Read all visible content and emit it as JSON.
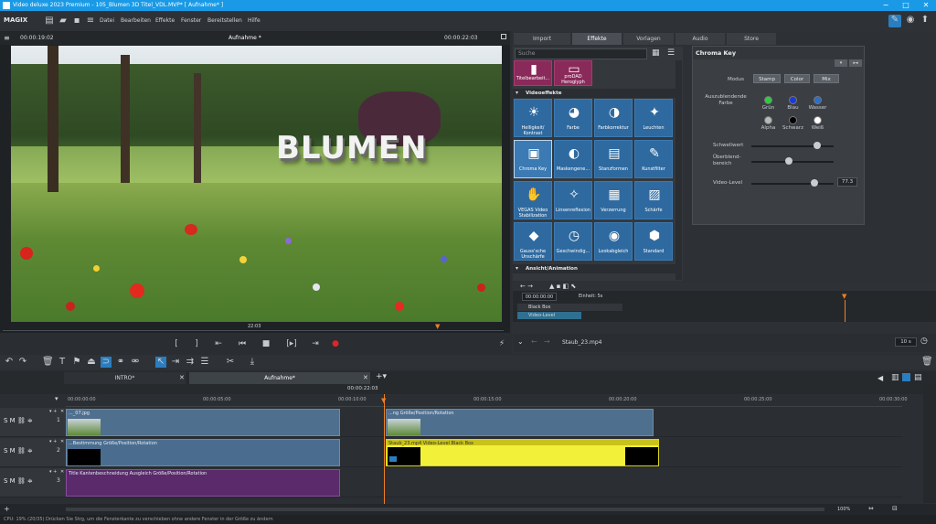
{
  "window": {
    "title": "Video deluxe 2023 Premium - 105_Blumen 3D Titel_VDL.MVP* [ Aufnahme* ]",
    "controls": [
      "−",
      "□",
      "✕"
    ]
  },
  "menu": {
    "logo": "MAGIX",
    "items": [
      "Datei",
      "Bearbeiten",
      "Effekte",
      "Fenster",
      "Bereitstellen",
      "Hilfe"
    ]
  },
  "preview": {
    "timecode_left": "00:00:19:02",
    "title": "Aufnahme *",
    "timecode_right": "00:00:22:03",
    "overlay_text": "BLUMEN",
    "position_marker": "22:03"
  },
  "right_panel": {
    "tabs": [
      "Import",
      "Effekte",
      "Vorlagen",
      "Audio",
      "Store"
    ],
    "active_tab": "Effekte",
    "search_placeholder": "Suche",
    "top_tiles": [
      {
        "label": "Titelbearbeit...",
        "icon": "title-editor-icon"
      },
      {
        "label": "proDAD Heroglyph",
        "icon": "heroglyph-icon"
      }
    ],
    "section_video": "Videoeffekte",
    "section_anim": "Ansicht/Animation",
    "effects": [
      {
        "label": "Helligkeit/ Kontrast",
        "icon": "brightness-icon",
        "glyph": "☀"
      },
      {
        "label": "Farbe",
        "icon": "palette-icon",
        "glyph": "◕"
      },
      {
        "label": "Farbkorrektur",
        "icon": "color-correction-icon",
        "glyph": "◑"
      },
      {
        "label": "Leuchten",
        "icon": "glow-icon",
        "glyph": "✦"
      },
      {
        "label": "Chroma Key",
        "icon": "chroma-key-icon",
        "glyph": "▣"
      },
      {
        "label": "Maskengene...",
        "icon": "mask-icon",
        "glyph": "◐"
      },
      {
        "label": "Stanzformen",
        "icon": "shapes-icon",
        "glyph": "▤"
      },
      {
        "label": "Kunstfilter",
        "icon": "art-filter-icon",
        "glyph": "✎"
      },
      {
        "label": "VEGAS Video Stabilization",
        "icon": "stabilization-icon",
        "glyph": "✋"
      },
      {
        "label": "Linsenreflexion",
        "icon": "lens-flare-icon",
        "glyph": "✧"
      },
      {
        "label": "Verzerrung",
        "icon": "distortion-icon",
        "glyph": "▦"
      },
      {
        "label": "Schärfe",
        "icon": "sharpness-icon",
        "glyph": "▨"
      },
      {
        "label": "Gauss'sche Unschärfe",
        "icon": "blur-icon",
        "glyph": "◆"
      },
      {
        "label": "Geschwindig...",
        "icon": "speed-icon",
        "glyph": "◷"
      },
      {
        "label": "Lookabgleich",
        "icon": "look-match-icon",
        "glyph": "◉"
      },
      {
        "label": "Standard",
        "icon": "standard-icon",
        "glyph": "⬢"
      }
    ]
  },
  "chroma_key": {
    "title": "Chroma Key",
    "modus_label": "Modus",
    "modus_options": [
      "Stamp",
      "Color",
      "Mix"
    ],
    "farbe_label": "Auszublendende Farbe",
    "colors": [
      {
        "label": "Grün",
        "hex": "#2ecc40"
      },
      {
        "label": "Blau",
        "hex": "#1b3bd6"
      },
      {
        "label": "Wasser",
        "hex": "#2a6fc9"
      },
      {
        "label": "Alpha",
        "hex": "#b9b9b9"
      },
      {
        "label": "Schwarz",
        "hex": "#000000"
      },
      {
        "label": "Weiß",
        "hex": "#ffffff"
      }
    ],
    "schwellwert_label": "Schwellwert",
    "schwellwert_level": 0.8,
    "ueberblend_label": "Überblend- bereich",
    "ueberblend_level": 0.45,
    "videolevel_label": "Video-Level",
    "videolevel_level": 0.77,
    "videolevel_value": "77.3"
  },
  "keyframe": {
    "time": "00:00:00:00",
    "unit": "Einheit: 5s",
    "rows": [
      "Black Box",
      "Video-Level"
    ]
  },
  "right_footer": {
    "file": "Staub_23.mp4",
    "duration": "10 s"
  },
  "timeline": {
    "tabs": [
      "INTRO*",
      "Aufnahme*"
    ],
    "current_time": "00:00:22:03",
    "ruler": [
      "00:00:00:00",
      "00:00:05:00",
      "00:00:10:00",
      "00:00:15:00",
      "00:00:20:00",
      "00:00:25:00",
      "00:00:30:00"
    ],
    "tracks": [
      {
        "num": "1",
        "clips": [
          {
            "label": "..._07.jpg",
            "kind": "photo"
          },
          {
            "label": "...ng   Größe/Position/Rotation",
            "kind": "photo"
          }
        ]
      },
      {
        "num": "2",
        "clips": [
          {
            "label": "...Bestimmung  Größe/Position/Rotation",
            "kind": "black"
          },
          {
            "label": "Staub_23.mp4   Video-Level Black Box",
            "kind": "yellow"
          }
        ]
      },
      {
        "num": "3",
        "clips": [
          {
            "label": "Title   Kantenbeschneidung Ausgleich  Größe/Position/Rotation",
            "kind": "title"
          }
        ]
      }
    ],
    "zoom": "100%"
  },
  "status": {
    "text": "CPU: 19% (20/35)   Drücken Sie Strg, um die Fensterkante zu verschieben ohne andere Fenster in der Größe zu ändern"
  }
}
